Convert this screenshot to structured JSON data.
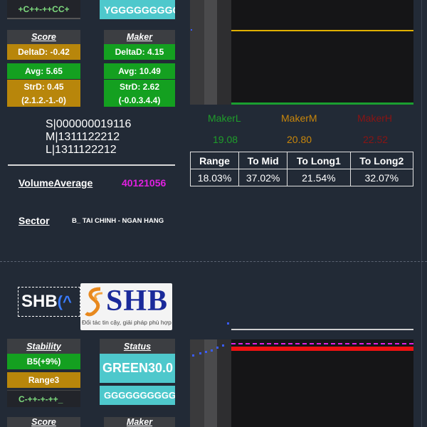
{
  "top_block": {
    "sig_top_partial": "+C++-++CC+",
    "status_top_partial": "YGGGGGGGGGG",
    "score": {
      "header": "Score",
      "delta": "DeltaD: -0.42",
      "avg": "Avg: 5.65",
      "str": "StrD: 0.45",
      "code": "(2.1.2.-1.-0)"
    },
    "maker": {
      "header": "Maker",
      "delta": "DeltaD: 4.15",
      "avg": "Avg: 10.49",
      "str": "StrD: 2.62",
      "code": "(-0.0.3.4.4)"
    },
    "sml": [
      "S|000000019116",
      "M|1311122212",
      "L|1311122212"
    ],
    "volume_label": "VolumeAverage",
    "volume_value": "40121056",
    "sector_label": "Sector",
    "sector_value": "B_ TAI CHINH - NGAN HANG",
    "maker_levels": [
      {
        "label": "MakerL",
        "value": "19.08",
        "color": "#1f9e2a"
      },
      {
        "label": "MakerM",
        "value": "20.80",
        "color": "#c8860b"
      },
      {
        "label": "MakerH",
        "value": "22.52",
        "color": "#8a1414"
      }
    ],
    "ranges": {
      "headers": [
        "Range",
        "To Mid",
        "To Long1",
        "To Long2"
      ],
      "values": [
        "18.03%",
        "37.02%",
        "21.54%",
        "32.07%"
      ]
    }
  },
  "bottom_block": {
    "ticker": "SHB",
    "ticker_suffix": "(^",
    "logo_text": "SHB",
    "logo_tagline": "Đối tác tin cậy, giải pháp phù hợp",
    "stability_header": "Stability",
    "stability_value": "B5(+9%)",
    "stability_range": "Range3",
    "stability_sig": "C-++-+-++_",
    "status_header": "Status",
    "status_value": "GREEN30.0",
    "status_seq": "GGGGGGGGGG",
    "score_header": "Score",
    "maker_header": "Maker"
  },
  "colors": {
    "background": "#222a36",
    "gold": "#b8860b",
    "green": "#14a020",
    "cyan": "#4ec8cc",
    "volume": "#e020e0"
  }
}
